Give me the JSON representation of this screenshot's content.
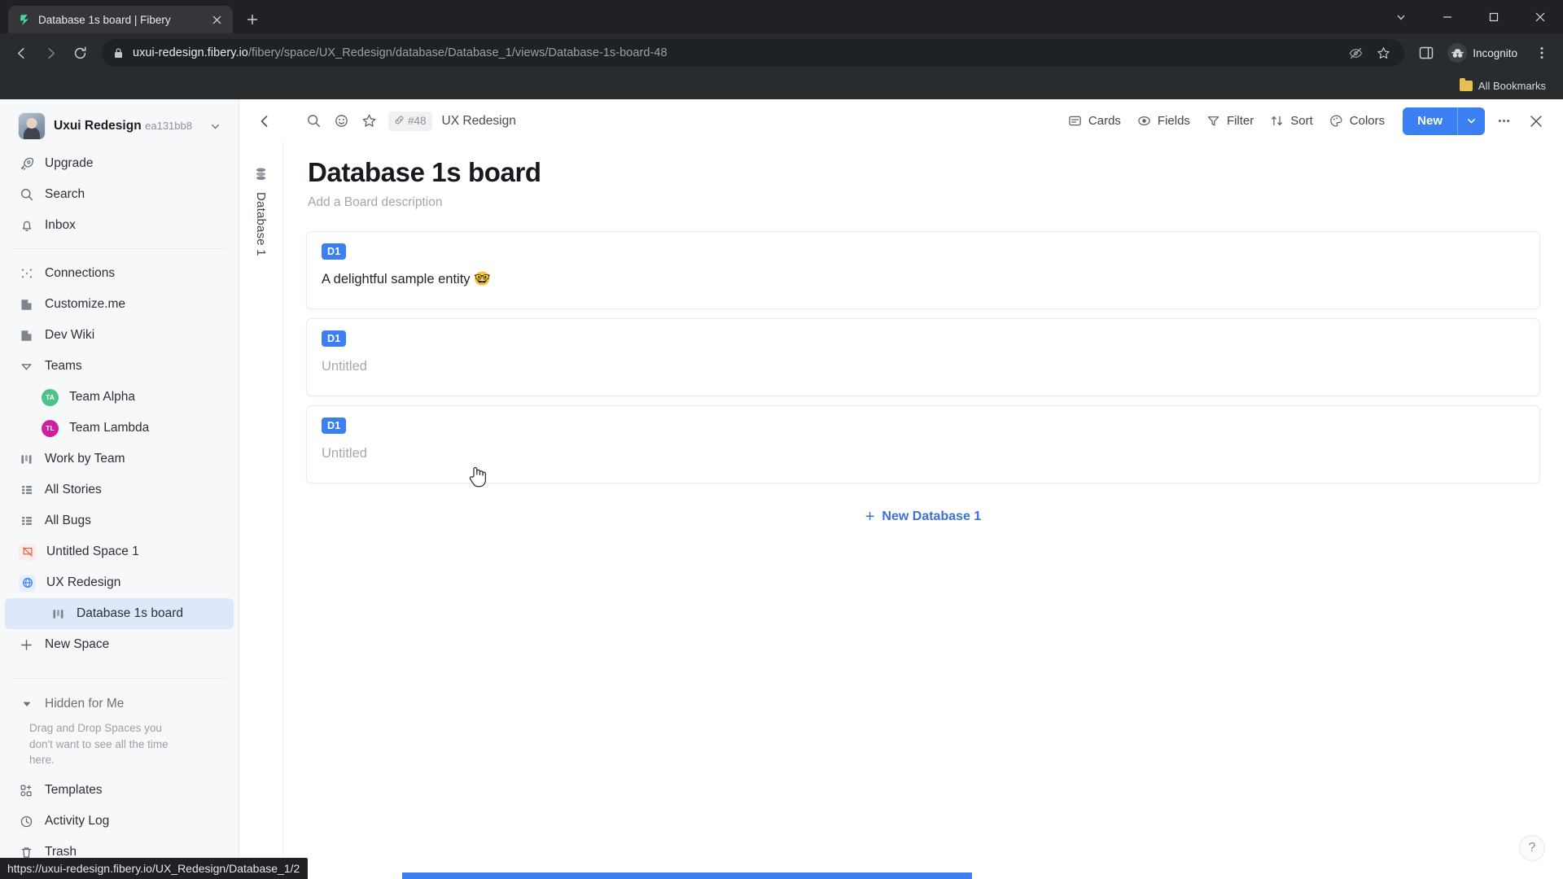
{
  "browser": {
    "tab": {
      "title": "Database 1s board | Fibery",
      "favicon": "fibery-logo-icon",
      "close_icon": "close-icon"
    },
    "new_tab_label": "+",
    "window_controls": {
      "minimize_to_tray": "chevron-down-icon",
      "minimize": "minimize-icon",
      "maximize": "maximize-icon",
      "close": "close-icon"
    },
    "nav": {
      "back": "back-arrow-icon",
      "forward": "forward-arrow-icon",
      "reload": "reload-icon"
    },
    "omnibox": {
      "lock_icon": "lock-icon",
      "url_host": "uxui-redesign.fibery.io",
      "url_path": "/fibery/space/UX_Redesign/database/Database_1/views/Database-1s-board-48",
      "view_site_info": "site-info-icon",
      "tracking_protection": "eye-off-icon",
      "bookmark_icon": "star-icon",
      "side_panel_icon": "side-panel-icon",
      "profile_label": "Incognito",
      "profile_icon": "incognito-icon",
      "menu_icon": "three-dots-vertical-icon"
    },
    "bookmarks": {
      "all_bookmarks_label": "All Bookmarks",
      "folder_icon": "folder-icon"
    },
    "status_bar": {
      "url": "https://uxui-redesign.fibery.io/UX_Redesign/Database_1/2"
    }
  },
  "sidebar": {
    "workspace": {
      "name": "Uxui Redesign",
      "id": "ea131bb8",
      "avatar": "user-avatar",
      "chevron": "chevron-down-icon"
    },
    "primary_items": [
      {
        "label": "Upgrade",
        "icon": "rocket-icon"
      },
      {
        "label": "Search",
        "icon": "search-icon"
      },
      {
        "label": "Inbox",
        "icon": "bell-icon"
      }
    ],
    "workspace_items": [
      {
        "label": "Connections",
        "icon": "connections-icon"
      },
      {
        "label": "Customize.me",
        "icon": "document-icon"
      },
      {
        "label": "Dev Wiki",
        "icon": "document-icon"
      }
    ],
    "teams_group": {
      "label": "Teams",
      "icon": "chevron-collapse-icon",
      "expanded": true,
      "teams": [
        {
          "label": "Team Alpha",
          "initials": "TA",
          "color": "#4cc38a"
        },
        {
          "label": "Team Lambda",
          "initials": "TL",
          "color": "#cf1fa0"
        }
      ]
    },
    "views": [
      {
        "label": "Work by Team",
        "icon": "board-icon"
      },
      {
        "label": "All Stories",
        "icon": "grid-icon"
      },
      {
        "label": "All Bugs",
        "icon": "grid-icon"
      }
    ],
    "spaces": [
      {
        "label": "Untitled Space 1",
        "icon": "space-broken-icon",
        "icon_bg": "#fdecea",
        "icon_color": "#e4604c",
        "selected": false
      },
      {
        "label": "UX Redesign",
        "icon": "globe-icon",
        "icon_bg": "#e6effd",
        "icon_color": "#3b7ff2",
        "selected": false
      }
    ],
    "space_children": [
      {
        "label": "Database 1s board",
        "icon": "board-icon",
        "selected": true
      }
    ],
    "new_space": {
      "label": "New Space",
      "icon": "plus-icon"
    },
    "hidden_for_me": {
      "label": "Hidden for Me",
      "icon": "caret-down-icon",
      "hint": "Drag and Drop Spaces you don't want to see all the time here."
    },
    "bottom_items": [
      {
        "label": "Templates",
        "icon": "templates-icon"
      },
      {
        "label": "Activity Log",
        "icon": "clock-icon"
      },
      {
        "label": "Trash",
        "icon": "trash-icon"
      }
    ]
  },
  "toolbar": {
    "back_icon": "back-arrow-icon",
    "search_icon": "search-icon",
    "emoji_icon": "emoji-icon",
    "favorite_icon": "star-icon",
    "link_badge": {
      "icon": "link-icon",
      "label": "#48"
    },
    "breadcrumb": "UX Redesign",
    "actions": [
      {
        "label": "Cards",
        "icon": "cards-icon"
      },
      {
        "label": "Fields",
        "icon": "fields-icon"
      },
      {
        "label": "Filter",
        "icon": "filter-icon"
      },
      {
        "label": "Sort",
        "icon": "sort-icon"
      },
      {
        "label": "Colors",
        "icon": "palette-icon"
      }
    ],
    "new_button": {
      "label": "New",
      "chevron": "chevron-down-icon",
      "color": "#3b7ff2"
    },
    "more_icon": "three-dots-icon",
    "close_icon": "close-icon"
  },
  "board": {
    "rail": {
      "icon": "database-icon",
      "label": "Database 1"
    },
    "title": "Database 1s board",
    "description_placeholder": "Add a Board description",
    "cards": [
      {
        "badge": "D1",
        "title": "A delightful sample entity 🤓",
        "placeholder": false
      },
      {
        "badge": "D1",
        "title": "Untitled",
        "placeholder": true
      },
      {
        "badge": "D1",
        "title": "Untitled",
        "placeholder": true
      }
    ],
    "new_entity": {
      "plus": "+",
      "label": "New Database 1"
    },
    "help_button": {
      "label": "?",
      "icon": "help-icon"
    }
  }
}
